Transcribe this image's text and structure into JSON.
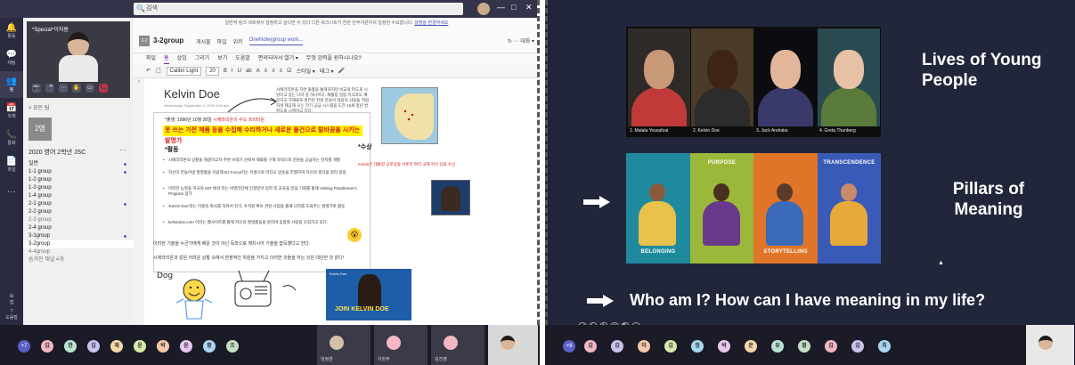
{
  "left_screen": {
    "search_placeholder": "검색",
    "window_controls": [
      "—",
      "□",
      "✕"
    ],
    "rail": [
      {
        "icon": "bell-icon",
        "glyph": "🔔",
        "label": "활동"
      },
      {
        "icon": "chat-icon",
        "glyph": "💬",
        "label": "채팅"
      },
      {
        "icon": "teams-icon",
        "glyph": "👥",
        "label": "팀"
      },
      {
        "icon": "calendar-icon",
        "glyph": "📅",
        "label": "과제"
      },
      {
        "icon": "phone-icon",
        "glyph": "📞",
        "label": "통화"
      },
      {
        "icon": "files-icon",
        "glyph": "📄",
        "label": "파일"
      },
      {
        "icon": "more-icon",
        "glyph": "···",
        "label": ""
      }
    ],
    "rail_bottom": {
      "apps": "앱",
      "help": "도움말"
    },
    "call": {
      "participant_name": "*Special*이지원",
      "controls": [
        "📷",
        "🎤",
        "⋯",
        "✋",
        "▭",
        "📞"
      ]
    },
    "channel_meeting": {
      "name": "1-2group",
      "sub": "회의 참석 1h00"
    },
    "back_label": "< 모든 팀",
    "team_tile": "2영",
    "team_name": "2020 영어 2학년 JSC",
    "channels": [
      {
        "name": "일반",
        "dot": true,
        "state": "normal"
      },
      {
        "name": "1-1 group",
        "dot": true,
        "state": "normal"
      },
      {
        "name": "1-2 group",
        "dot": false,
        "state": "normal"
      },
      {
        "name": "1-3 group",
        "dot": false,
        "state": "normal"
      },
      {
        "name": "1-4 group",
        "dot": false,
        "state": "normal"
      },
      {
        "name": "2-1 group",
        "dot": true,
        "state": "normal"
      },
      {
        "name": "2-2 group",
        "dot": false,
        "state": "normal"
      },
      {
        "name": "2-3 group",
        "dot": false,
        "state": "dim"
      },
      {
        "name": "2-4 group",
        "dot": false,
        "state": "normal"
      },
      {
        "name": "3-1group",
        "dot": true,
        "state": "normal"
      },
      {
        "name": "3-2group",
        "dot": false,
        "state": "active"
      },
      {
        "name": "4-4group",
        "dot": false,
        "state": "dim"
      },
      {
        "name": "숨겨진 채널 4개",
        "dot": false,
        "state": "dim"
      }
    ],
    "banner_text": "일반적 링크 세트에서 설정하고 싶다면 수 있다 다른 워크시트가 연관 전부지원하셔 일정한 수요합니다.",
    "banner_link": "설정을 변경하세요",
    "onenote_header": {
      "tile": "3-2",
      "team": "3-2group",
      "tabs": [
        "게시물",
        "파일",
        "위키",
        "OneNote(group work..."
      ],
      "active_tab": 3,
      "right": "↻ ⋯ 대화 ▾"
    },
    "ribbon_tabs": [
      "파일",
      "홈",
      "삽입",
      "그리기",
      "보기",
      "도움말",
      "편의되어서 열기 ▾",
      "무엇 입력을 원하시나요?"
    ],
    "active_ribbon_tab": 1,
    "ribbon_font": "Calibri Light",
    "ribbon_size": "20",
    "ribbon_tools": [
      "B",
      "I",
      "U",
      "ab",
      "A",
      "≡",
      "≡",
      "≡",
      "☑",
      "스타일 ▾",
      "태그 ▾",
      "🎤"
    ],
    "page": {
      "title": "Kelvin Doe",
      "date": "Wednesday, September 2, 2020   9:50 AM",
      "note": "시에라리온을 자연 물품을 통해하지만 비교의 파도로 시달리고 있는 나라 중 하나이다. 재활용 집합 지식과도 깨끗하고 가재료로 발전한 전원 만들어 대량의 사람들 저렴하게 제공해 오는 전기 공급 시스템을 도전 15세 청년 발 정도로 시행하고 있다.",
      "line1_prefix": "*출생: 1996년 10월 26일 ",
      "line1_red": "시에라리온의 수도 프리타운",
      "highlight": "못 쓰는 가전 제품 등을 수집해 수리하거나 새로운 물건으로 탈바꿈을 시키는 발명가",
      "section": "*활동",
      "bullets": [
        "시에라리온의 상황을 해결하고자 주변 쓰레기 산에서 재료를 구해 자력으로 전원을 공급하는 전지를 개발",
        "자신이 만들어낸 발명품을 이용해 DJ Focus라는 이름으로 라디오 방송을 진행하며 자신의 생각을 널리 알림",
        "이러한 능력을 미국의 MIT 에서 라는 비영리단체 인정받아 입학 후 교육을 받을 기회를 통해 Visiting Practitioner's Program 참가",
        "'Kelvin Doe'라는 이름의 회사를 차려서 전기, 수자원 확보 관련 사업을 통해 나라를 도와주는 발명가로 활동",
        "kelvindoe.com 이라는 웹사이트를 통해 자신의 발명품들을 알리며 동참할 사람을 모집하고 있다."
      ],
      "award_title": "*수상",
      "award_text": "Kelvin은 대통령 공로상을 비롯한 여러 국제 혁신 상을 수상",
      "body1": "이러한 기술을 누군가에게 배운 것이 아닌 독학으로 깨치시어 기술을 습득했다고 한다.",
      "body2": "시에라리온과 같은 어려운 상황 속에서 한정적인 자원을 가지고 이러한 것들을 하는 것은 대단한 것 같다!",
      "sketch_label": "Dog",
      "poster_top": "Kelvin Doe",
      "poster_main": "JOIN KELVIN DOE"
    },
    "strip": {
      "badge": "+7",
      "circles": [
        {
          "t": "김",
          "c": "#f2b7c3"
        },
        {
          "t": "한",
          "c": "#b9e3d2"
        },
        {
          "t": "김",
          "c": "#c8c4ef"
        },
        {
          "t": "재",
          "c": "#f5d9a8"
        },
        {
          "t": "윤",
          "c": "#d6e9a8"
        },
        {
          "t": "박",
          "c": "#f5c7a8"
        },
        {
          "t": "윤",
          "c": "#e9c7ef"
        },
        {
          "t": "황",
          "c": "#a8d8ef"
        },
        {
          "t": "조",
          "c": "#c4e0c4"
        }
      ],
      "tiles": [
        {
          "name": "임정훈",
          "color": "#d4c2a8"
        },
        {
          "name": "이현주",
          "color": "#f2b7c3"
        },
        {
          "name": "김진영",
          "color": "#f2b7c3"
        }
      ]
    }
  },
  "right_screen": {
    "title1": "Lives of Young People",
    "photos": [
      {
        "caption": "1. Malala Yousafzai",
        "bg": "#2e2a28",
        "skin": "#c99877",
        "cloth": "#c03a3a"
      },
      {
        "caption": "2. Kelvin Doe",
        "bg": "#4a3a28",
        "skin": "#3d2416",
        "cloth": "#2c2c2c"
      },
      {
        "caption": "3. Jack Andraka",
        "bg": "#0c0c10",
        "skin": "#e2b69a",
        "cloth": "#3a3a6a"
      },
      {
        "caption": "4. Greta Thunberg",
        "bg": "#2a4a52",
        "skin": "#e8c2a6",
        "cloth": "#5a7a3a"
      }
    ],
    "title2": "Pillars of Meaning",
    "pillars": [
      {
        "label": "BELONGING",
        "bg": "#1f8a9e",
        "skin": "#8a5a3a",
        "cloth": "#e8c24a",
        "pos": "bottom"
      },
      {
        "label": "PURPOSE",
        "bg": "#9bb83a",
        "skin": "#4a2e1e",
        "cloth": "#6a3a8a",
        "pos": "top"
      },
      {
        "label": "STORYTELLING",
        "bg": "#e0752a",
        "skin": "#5a3a28",
        "cloth": "#3a6ab8",
        "pos": "bottom"
      },
      {
        "label": "TRANSCENDENCE",
        "bg": "#3a5ab8",
        "skin": "#c98a6a",
        "cloth": "#e8a83a",
        "pos": "top"
      }
    ],
    "question": "Who am I? How can I have meaning in my life?",
    "pres_controls": [
      "◀",
      "▶",
      "✎",
      "⊙",
      "🔍",
      "⋯"
    ],
    "strip": {
      "badge": "+8",
      "circles": [
        {
          "t": "김",
          "c": "#f2b7c3"
        },
        {
          "t": "김",
          "c": "#c8c4ef"
        },
        {
          "t": "이",
          "c": "#f5c7a8"
        },
        {
          "t": "김",
          "c": "#d6e9a8"
        },
        {
          "t": "정",
          "c": "#a8d8ef"
        },
        {
          "t": "박",
          "c": "#e9c7ef"
        },
        {
          "t": "문",
          "c": "#f5d9a8"
        },
        {
          "t": "유",
          "c": "#b9e3d2"
        },
        {
          "t": "황",
          "c": "#c4e0c4"
        },
        {
          "t": "김",
          "c": "#f2b7c3"
        },
        {
          "t": "김",
          "c": "#c8c4ef"
        },
        {
          "t": "최",
          "c": "#a8d8ef"
        }
      ]
    }
  }
}
